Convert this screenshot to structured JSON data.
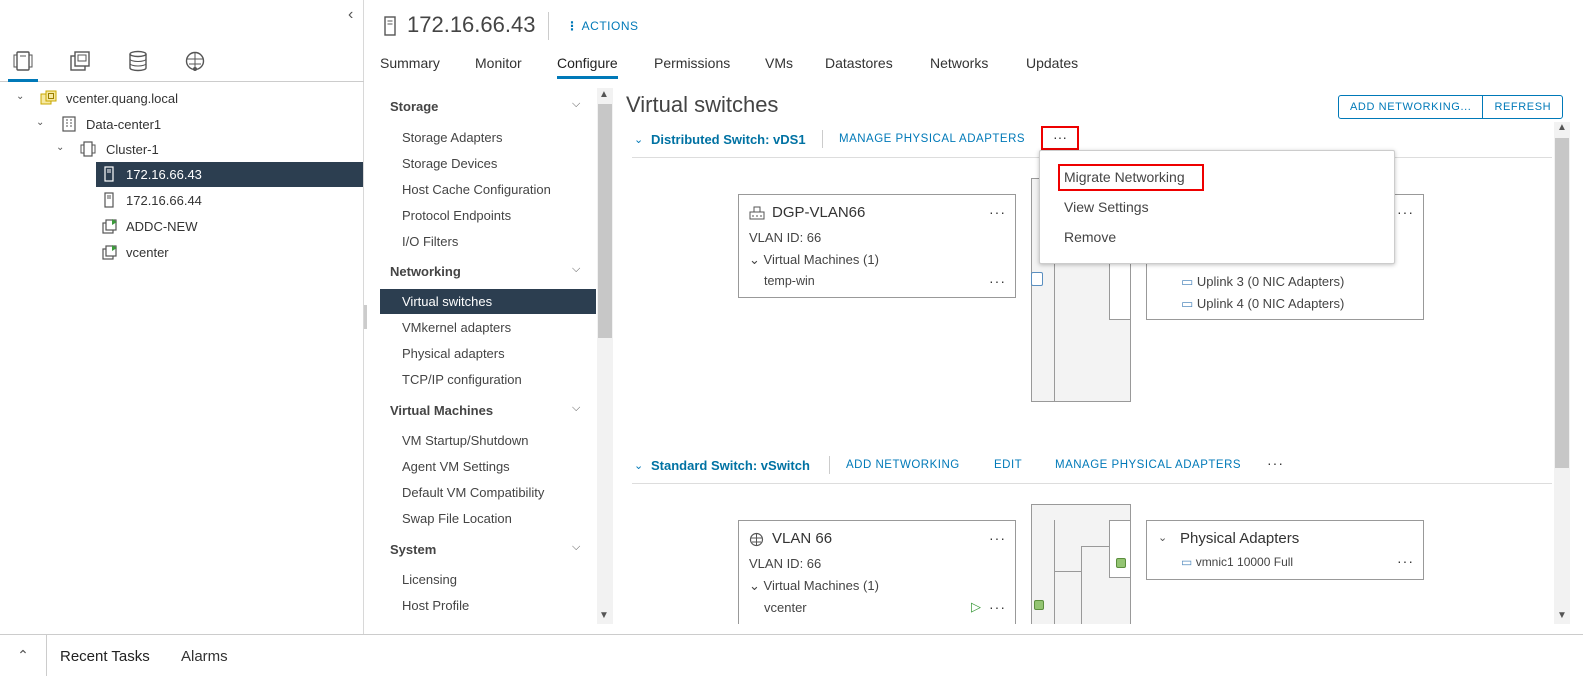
{
  "inventory": {
    "tree": [
      {
        "label": "vcenter.quang.local",
        "icon": "vcenter-icon"
      },
      {
        "label": "Data-center1",
        "icon": "datacenter-icon"
      },
      {
        "label": "Cluster-1",
        "icon": "cluster-icon"
      },
      {
        "label": "172.16.66.43",
        "icon": "host-icon",
        "selected": true
      },
      {
        "label": "172.16.66.44",
        "icon": "host-icon"
      },
      {
        "label": "ADDC-NEW",
        "icon": "vm-icon"
      },
      {
        "label": "vcenter",
        "icon": "vm-icon"
      }
    ]
  },
  "header": {
    "title": "172.16.66.43",
    "actions_label": "ACTIONS"
  },
  "tabs": [
    "Summary",
    "Monitor",
    "Configure",
    "Permissions",
    "VMs",
    "Datastores",
    "Networks",
    "Updates"
  ],
  "active_tab": "Configure",
  "configure_nav": {
    "storage": {
      "title": "Storage",
      "items": [
        "Storage Adapters",
        "Storage Devices",
        "Host Cache Configuration",
        "Protocol Endpoints",
        "I/O Filters"
      ]
    },
    "networking": {
      "title": "Networking",
      "items": [
        "Virtual switches",
        "VMkernel adapters",
        "Physical adapters",
        "TCP/IP configuration"
      ]
    },
    "virtual_machines": {
      "title": "Virtual Machines",
      "items": [
        "VM Startup/Shutdown",
        "Agent VM Settings",
        "Default VM Compatibility",
        "Swap File Location"
      ]
    },
    "system": {
      "title": "System",
      "items": [
        "Licensing",
        "Host Profile"
      ]
    },
    "selected": "Virtual switches"
  },
  "content": {
    "title": "Virtual switches",
    "add_networking_btn": "ADD NETWORKING...",
    "refresh_btn": "REFRESH",
    "distributed_switch": {
      "title": "Distributed Switch: vDS1",
      "manage_link": "MANAGE PHYSICAL ADAPTERS",
      "more": "···",
      "portgroup": {
        "name": "DGP-VLAN66",
        "vlan": "VLAN ID: 66",
        "vms": "Virtual Machines (1)",
        "vm": "temp-win"
      },
      "uplinks": [
        "Uplink 3 (0 NIC Adapters)",
        "Uplink 4 (0 NIC Adapters)"
      ]
    },
    "standard_switch": {
      "title": "Standard Switch: vSwitch",
      "add_link": "ADD NETWORKING",
      "edit_link": "EDIT",
      "manage_link": "MANAGE PHYSICAL ADAPTERS",
      "more": "···",
      "portgroup": {
        "name": "VLAN 66",
        "vlan": "VLAN ID: 66",
        "vms": "Virtual Machines (1)",
        "vm": "vcenter"
      },
      "physical": {
        "title": "Physical Adapters",
        "nic": "vmnic1 10000 Full"
      }
    }
  },
  "context_menu": {
    "items": [
      "Migrate Networking",
      "View Settings",
      "Remove"
    ],
    "highlighted": "Migrate Networking"
  },
  "bottom_bar": {
    "tabs": [
      "Recent Tasks",
      "Alarms"
    ]
  },
  "colors": {
    "accent": "#0079b8",
    "selected_bg": "#2c3e50",
    "highlight": "#ee0000",
    "port_green": "#93c472"
  }
}
